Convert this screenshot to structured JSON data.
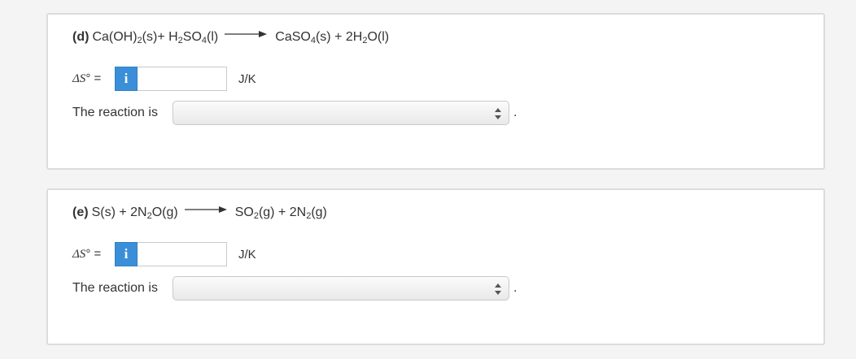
{
  "parts": [
    {
      "label": "(d)",
      "reactants": [
        {
          "pre": "Ca(OH)",
          "sub": "2",
          "post": "(s)"
        },
        {
          "pre": " + H",
          "sub": "2",
          "post": "SO"
        },
        {
          "pre": "",
          "sub": "4",
          "post": "(l)"
        }
      ],
      "products": [
        {
          "pre": "CaSO",
          "sub": "4",
          "post": "(s) + 2H"
        },
        {
          "pre": "",
          "sub": "2",
          "post": "O(l)"
        }
      ],
      "ds_label": "ΔS° =",
      "info_label": "i",
      "ds_value": "",
      "unit": "J/K",
      "reaction_label": "The reaction is",
      "selected_option": "",
      "period": "."
    },
    {
      "label": "(e)",
      "reactants": [
        {
          "pre": "S(s) + 2N",
          "sub": "2",
          "post": "O(g)"
        }
      ],
      "products": [
        {
          "pre": "SO",
          "sub": "2",
          "post": "(g) + 2N"
        },
        {
          "pre": "",
          "sub": "2",
          "post": "(g)"
        }
      ],
      "ds_label": "ΔS° =",
      "info_label": "i",
      "ds_value": "",
      "unit": "J/K",
      "reaction_label": "The reaction is",
      "selected_option": "",
      "period": "."
    }
  ],
  "colors": {
    "info_button": "#3b8fd9",
    "card_border": "#dcdcdc",
    "background": "#f4f4f4"
  },
  "icons": {
    "info": "info-icon",
    "arrow": "reaction-arrow-icon",
    "select": "select-arrows-icon"
  }
}
